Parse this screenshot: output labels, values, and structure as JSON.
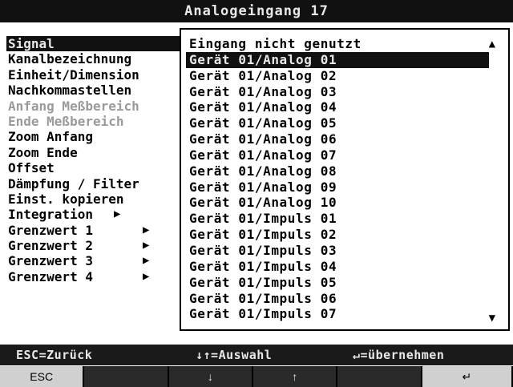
{
  "title": "Analogeingang 17",
  "menu": {
    "items": [
      {
        "label": "Signal",
        "state": "selected"
      },
      {
        "label": "Kanalbezeichnung",
        "state": "normal"
      },
      {
        "label": "Einheit/Dimension",
        "state": "normal"
      },
      {
        "label": "Nachkommastellen",
        "state": "normal"
      },
      {
        "label": "Anfang Meßbereich",
        "state": "disabled"
      },
      {
        "label": "Ende Meßbereich",
        "state": "disabled"
      },
      {
        "label": "Zoom Anfang",
        "state": "normal"
      },
      {
        "label": "Zoom Ende",
        "state": "normal"
      },
      {
        "label": "Offset",
        "state": "normal"
      },
      {
        "label": "Dämpfung / Filter",
        "state": "normal"
      },
      {
        "label": "Einst. kopieren",
        "state": "normal"
      },
      {
        "label": "Integration",
        "state": "normal"
      },
      {
        "label": "Grenzwert 1",
        "state": "normal"
      },
      {
        "label": "Grenzwert 2",
        "state": "normal"
      },
      {
        "label": "Grenzwert 3",
        "state": "normal"
      },
      {
        "label": "Grenzwert 4",
        "state": "normal"
      }
    ],
    "submenu_arrow": "▶"
  },
  "popup": {
    "options": [
      "Eingang nicht genutzt",
      "Gerät 01/Analog 01",
      "Gerät 01/Analog 02",
      "Gerät 01/Analog 03",
      "Gerät 01/Analog 04",
      "Gerät 01/Analog 05",
      "Gerät 01/Analog 06",
      "Gerät 01/Analog 07",
      "Gerät 01/Analog 08",
      "Gerät 01/Analog 09",
      "Gerät 01/Analog 10",
      "Gerät 01/Impuls 01",
      "Gerät 01/Impuls 02",
      "Gerät 01/Impuls 03",
      "Gerät 01/Impuls 04",
      "Gerät 01/Impuls 05",
      "Gerät 01/Impuls 06",
      "Gerät 01/Impuls 07"
    ],
    "selected_index": 1,
    "scroll_up": "▲",
    "scroll_down": "▼"
  },
  "help_bar": {
    "esc": "ESC=Zurück",
    "select": "↓↑=Auswahl",
    "accept": "↵=übernehmen"
  },
  "softkeys": [
    {
      "label": "ESC",
      "icon": "esc-label",
      "style": "light"
    },
    {
      "label": "",
      "icon": "",
      "style": "dark"
    },
    {
      "label": "↓",
      "icon": "arrow-down-icon",
      "style": "dark"
    },
    {
      "label": "↑",
      "icon": "arrow-up-icon",
      "style": "dark"
    },
    {
      "label": "",
      "icon": "",
      "style": "dark"
    },
    {
      "label": "↵",
      "icon": "enter-icon",
      "style": "light"
    }
  ],
  "colors": {
    "background": "#ffffff",
    "inverse": "#111111",
    "disabled": "#9a9a9a"
  }
}
